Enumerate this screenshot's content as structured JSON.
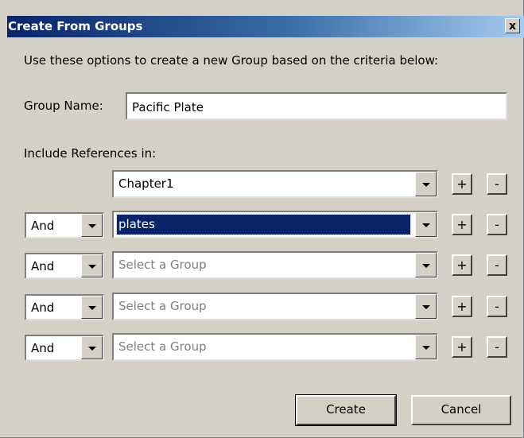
{
  "dialog": {
    "title": "Create From Groups",
    "close_label": "x",
    "instructions": "Use these options to create a new Group based on the criteria below:",
    "group_name_label": "Group Name:",
    "group_name_value": "Pacific Plate",
    "include_label": "Include References in:",
    "rows": [
      {
        "operator": "",
        "group": "Chapter1",
        "placeholder": false,
        "selected": false
      },
      {
        "operator": "And",
        "group": "plates",
        "placeholder": false,
        "selected": true
      },
      {
        "operator": "And",
        "group": "Select a Group",
        "placeholder": true,
        "selected": false
      },
      {
        "operator": "And",
        "group": "Select a Group",
        "placeholder": true,
        "selected": false
      },
      {
        "operator": "And",
        "group": "Select a Group",
        "placeholder": true,
        "selected": false
      }
    ],
    "add_label": "+",
    "remove_label": "-",
    "create_label": "Create",
    "cancel_label": "Cancel"
  },
  "colors": {
    "titlebar_start": "#0a246a",
    "titlebar_end": "#a6caf0",
    "dialog_bg": "#d4d0c8",
    "selection": "#0a246a"
  },
  "icons": {
    "dropdown": "chevron-down-icon",
    "close": "close-icon"
  }
}
